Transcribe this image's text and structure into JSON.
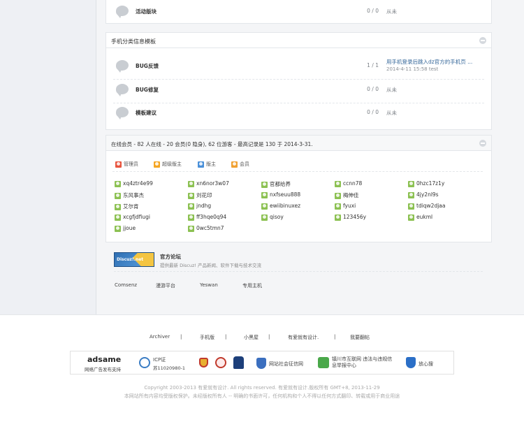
{
  "colors": {
    "link": "#336699",
    "member_icon": "#8cc152",
    "admin_icon": "#e8553e",
    "supermod_icon": "#f5a623",
    "mod_icon": "#4a90d9",
    "groupmember_icon": "#f0a030"
  },
  "top_forum": {
    "name": "活动版块",
    "count": "0 / 0",
    "last": "从未"
  },
  "mobile_category": {
    "title": "手机分类信息模板",
    "forums": [
      {
        "name": "BUG反馈",
        "count": "1 / 1",
        "last_link": "用手机登录后跳入dz官方的手机页 ...",
        "last_meta": "2014-4-11 15:58 test"
      },
      {
        "name": "BUG修复",
        "count": "0 / 0",
        "last": "从未"
      },
      {
        "name": "模板建议",
        "count": "0 / 0",
        "last": "从未"
      }
    ]
  },
  "online": {
    "title": "在线会员 - 82 人在线 - 20 会员(0 隐身), 62 位游客 - 最高记录是 130 于 2014-3-31.",
    "legend": [
      "管理员",
      "超级版主",
      "版主",
      "会员"
    ],
    "users": [
      "xq4ztr4e99",
      "xn6nor3w07",
      "官都给养",
      "ccnn78",
      "0hzc17z1y",
      "东风事杰",
      "刘花印",
      "nxfseuu888",
      "梅伸佳",
      "4jy2nl9s",
      "艾尔肯",
      "jndhg",
      "ewiibinuxez",
      "fyuxi",
      "tdiqw2djaa",
      "xcgfjdfiugi",
      "ff3hqe0q94",
      "qisoy",
      "123456y",
      "eukml",
      "jjoue",
      "0wc5tmn7"
    ]
  },
  "links": {
    "official_title": "官方论坛",
    "official_desc": "提供最新 Discuz! 产品新闻、软件下载与技术交流",
    "logo_text": "Discuz!.net",
    "partners": [
      "Comsenz",
      "漫游平台",
      "Yeswan",
      "专用主机"
    ]
  },
  "footer": {
    "links": [
      "Archiver",
      "手机版",
      "小黑屋",
      "有爱就有设计.",
      "我要翻帖"
    ],
    "badges": {
      "adsame_logo": "adsame",
      "adsame_sub": "网络广告发布支持",
      "icp_title": "ICP证",
      "icp_number": "苏11020980-1",
      "net_police": "网站社会征信网",
      "internet": "镇川市互联网 违法与违规信息举报中心",
      "trust": "放心搜"
    },
    "copyright": "Copyright 2003-2013 有爱就有设计. All rights reserved. 有爱就有设计.版权所有 GMT+8, 2013-11-29",
    "notice": "本网站所有内容均受版权保护。未经版权所有人 -- 明确的书面许可，任何机构和个人不得以任何方式翻印、转载或用于商业用途"
  }
}
